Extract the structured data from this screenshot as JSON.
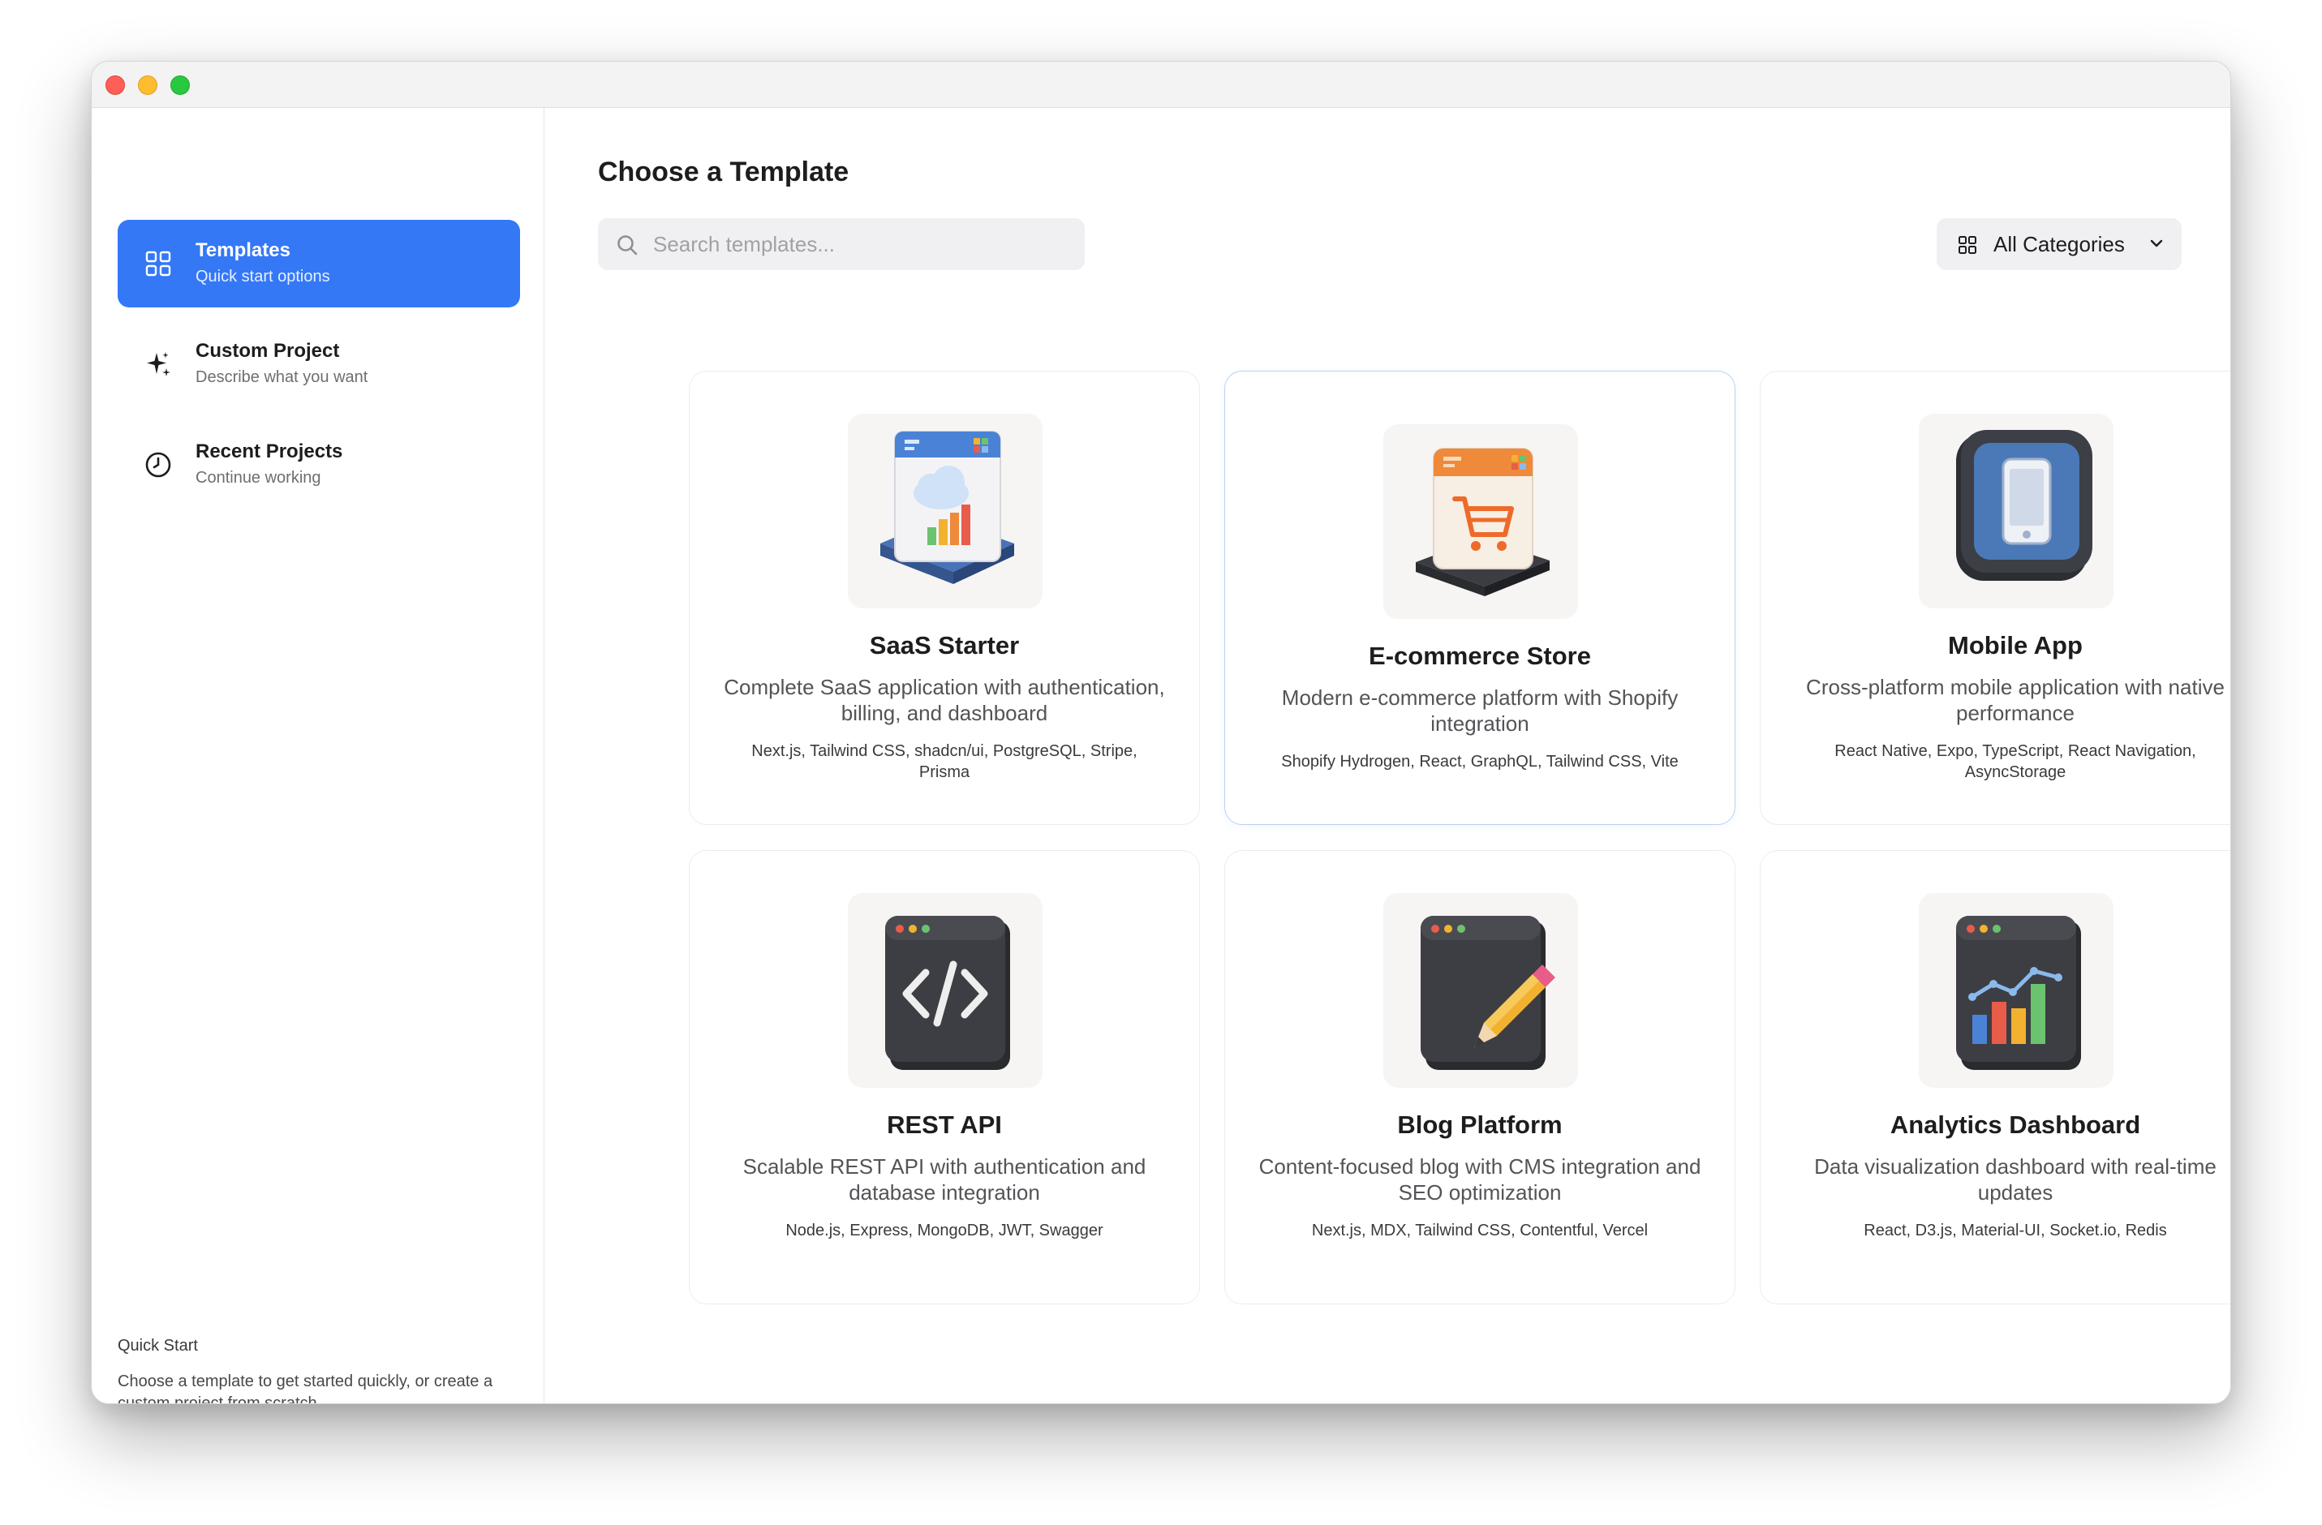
{
  "sidebar": {
    "items": [
      {
        "title": "Templates",
        "subtitle": "Quick start options",
        "icon": "grid-icon",
        "active": true
      },
      {
        "title": "Custom Project",
        "subtitle": "Describe what you want",
        "icon": "sparkle-icon",
        "active": false
      },
      {
        "title": "Recent Projects",
        "subtitle": "Continue working",
        "icon": "clock-icon",
        "active": false
      }
    ],
    "quick_start": {
      "title": "Quick Start",
      "text": "Choose a template to get started quickly, or create a custom project from scratch."
    }
  },
  "main": {
    "title": "Choose a Template",
    "search": {
      "placeholder": "Search templates...",
      "value": ""
    },
    "category_filter": {
      "label": "All Categories"
    }
  },
  "templates": [
    {
      "name": "SaaS Starter",
      "description": "Complete SaaS application with authentication, billing, and dashboard",
      "tech": "Next.js, Tailwind CSS, shadcn/ui, PostgreSQL, Stripe, Prisma",
      "icon": "saas-cloud-icon"
    },
    {
      "name": "E-commerce Store",
      "description": "Modern e-commerce platform with Shopify integration",
      "tech": "Shopify Hydrogen, React, GraphQL, Tailwind CSS, Vite",
      "icon": "shopping-cart-icon"
    },
    {
      "name": "Mobile App",
      "description": "Cross-platform mobile application with native performance",
      "tech": "React Native, Expo, TypeScript, React Navigation, AsyncStorage",
      "icon": "mobile-phone-icon"
    },
    {
      "name": "REST API",
      "description": "Scalable REST API with authentication and database integration",
      "tech": "Node.js, Express, MongoDB, JWT, Swagger",
      "icon": "code-brackets-icon"
    },
    {
      "name": "Blog Platform",
      "description": "Content-focused blog with CMS integration and SEO optimization",
      "tech": "Next.js, MDX, Tailwind CSS, Contentful, Vercel",
      "icon": "pencil-icon"
    },
    {
      "name": "Analytics Dashboard",
      "description": "Data visualization dashboard with real-time updates",
      "tech": "React, D3.js, Material-UI, Socket.io, Redis",
      "icon": "bar-chart-icon"
    }
  ],
  "colors": {
    "accent": "#3478f6",
    "card_border": "#ececee",
    "hover_border": "#b8d1f5"
  }
}
